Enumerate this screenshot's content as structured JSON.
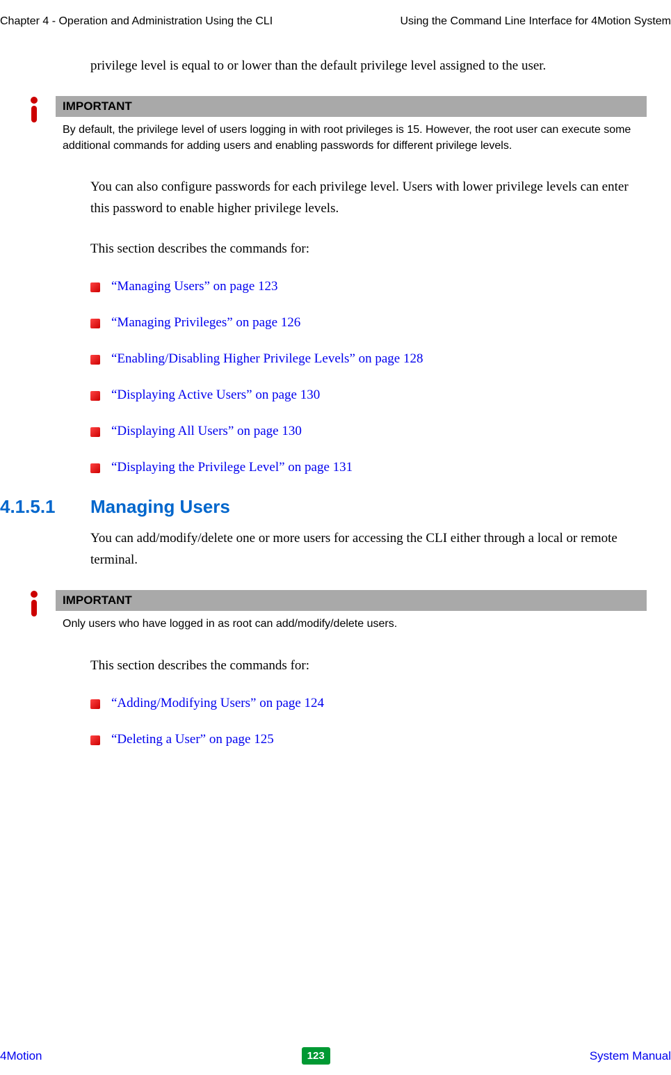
{
  "header": {
    "left": "Chapter 4 - Operation and Administration Using the CLI",
    "right": "Using the Command Line Interface for 4Motion System"
  },
  "intro_text": "privilege level is equal to or lower than the default privilege level assigned to the user.",
  "important1": {
    "label": "IMPORTANT",
    "body": "By default, the privilege level of users logging in with root privileges is 15. However, the root user can execute some additional commands for adding users and enabling passwords for different privilege levels."
  },
  "para2": "You can also configure passwords for each privilege level. Users with lower privilege levels can enter this password to enable higher privilege levels.",
  "para3": "This section describes the commands for:",
  "list1": [
    "“Managing Users” on page 123",
    "“Managing Privileges” on page 126",
    "“Enabling/Disabling Higher Privilege Levels” on page 128",
    "“Displaying Active Users” on page 130",
    "“Displaying All Users” on page 130",
    "“Displaying the Privilege Level” on page 131"
  ],
  "section": {
    "number": "4.1.5.1",
    "title": "Managing Users",
    "para": "You can add/modify/delete one or more users for accessing the CLI either through a local or remote terminal."
  },
  "important2": {
    "label": "IMPORTANT",
    "body": "Only users who have logged in as root can add/modify/delete users."
  },
  "para4": "This section describes the commands for:",
  "list2": [
    "“Adding/Modifying Users” on page 124",
    "“Deleting a User” on page 125"
  ],
  "footer": {
    "left": "4Motion",
    "page": "123",
    "right": "System Manual"
  }
}
